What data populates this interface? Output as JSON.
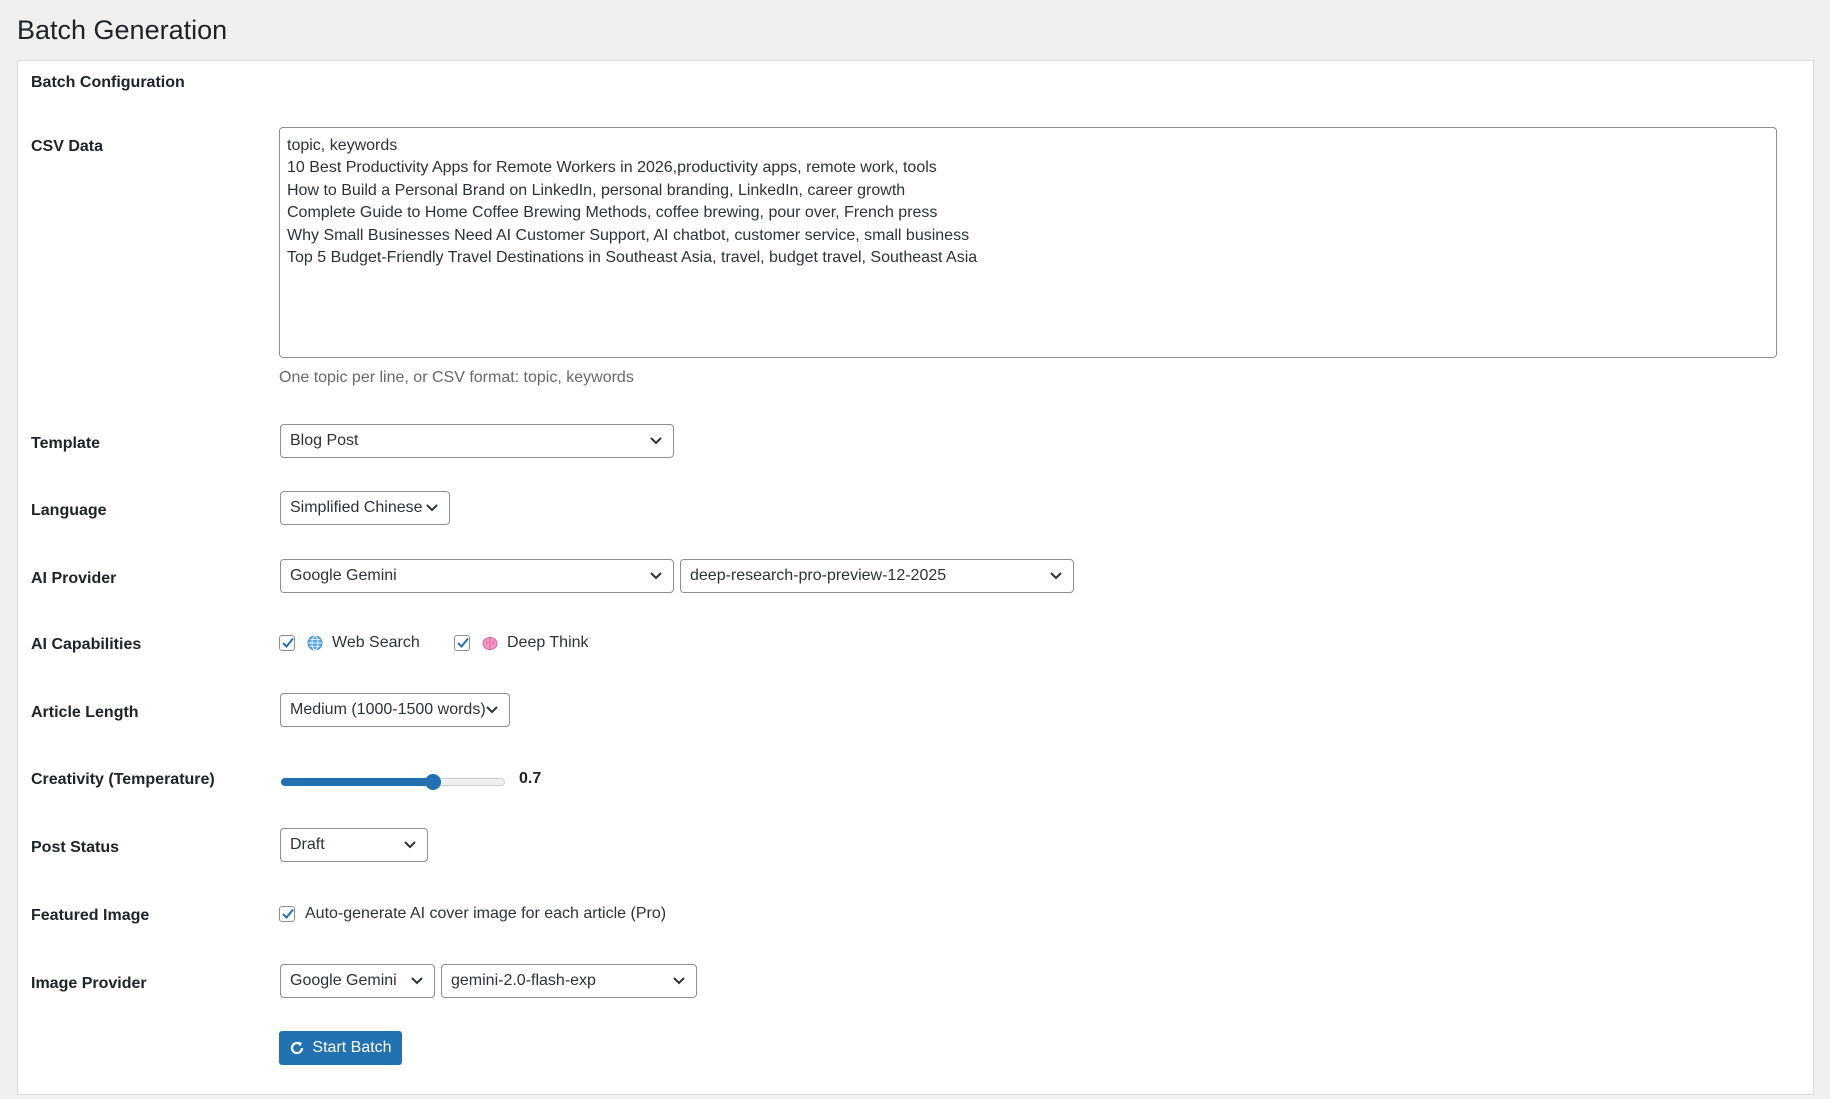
{
  "page": {
    "title": "Batch Generation"
  },
  "panel": {
    "title": "Batch Configuration"
  },
  "csv": {
    "label": "CSV Data",
    "value": "topic, keywords\n10 Best Productivity Apps for Remote Workers in 2026,productivity apps, remote work, tools\nHow to Build a Personal Brand on LinkedIn, personal branding, LinkedIn, career growth\nComplete Guide to Home Coffee Brewing Methods, coffee brewing, pour over, French press\nWhy Small Businesses Need AI Customer Support, AI chatbot, customer service, small business\nTop 5 Budget-Friendly Travel Destinations in Southeast Asia, travel, budget travel, Southeast Asia",
    "description": "One topic per line, or CSV format: topic, keywords"
  },
  "template": {
    "label": "Template",
    "selected": "Blog Post"
  },
  "language": {
    "label": "Language",
    "selected": "Simplified Chinese"
  },
  "ai_provider": {
    "label": "AI Provider",
    "selected": "Google Gemini",
    "model_selected": "deep-research-pro-preview-12-2025"
  },
  "ai_capabilities": {
    "label": "AI Capabilities",
    "web_search": {
      "label": "Web Search",
      "checked": true,
      "icon": "globe-icon"
    },
    "deep_think": {
      "label": "Deep Think",
      "checked": true,
      "icon": "brain-icon"
    }
  },
  "article_length": {
    "label": "Article Length",
    "selected": "Medium (1000-1500 words)"
  },
  "creativity": {
    "label": "Creativity (Temperature)",
    "value": 0.7,
    "value_text": "0.7",
    "fill_fraction": 0.68
  },
  "post_status": {
    "label": "Post Status",
    "selected": "Draft"
  },
  "featured_image": {
    "label": "Featured Image",
    "checkbox_label": "Auto-generate AI cover image for each article (Pro)",
    "checked": true
  },
  "image_provider": {
    "label": "Image Provider",
    "selected": "Google Gemini",
    "model_selected": "gemini-2.0-flash-exp"
  },
  "start_button": {
    "label": "Start Batch",
    "icon": "refresh-icon"
  },
  "colors": {
    "accent": "#2271b1",
    "border": "#8c8f94",
    "background": "#f0f0f1"
  }
}
